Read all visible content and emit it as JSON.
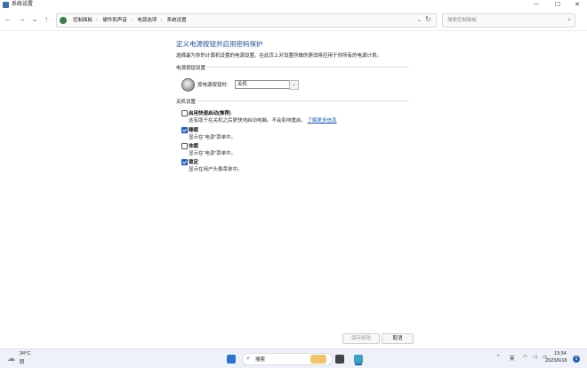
{
  "window": {
    "title": "系统设置",
    "min": "─",
    "max": "☐",
    "close": "✕"
  },
  "nav": {
    "back": "←",
    "forward": "→",
    "recent": "⌄",
    "up": "↑",
    "refresh": "↻",
    "addr_drop": "⌄"
  },
  "breadcrumbs": [
    "控制面板",
    "硬件和声音",
    "电源选项",
    "系统设置"
  ],
  "search": {
    "placeholder": "搜索控制面板"
  },
  "page": {
    "heading": "定义电源按钮并启用密码保护",
    "description": "选择最为你的计算机设置的电源设置。在此页上对设置所做的更改将应用于你所有的电源计划。"
  },
  "power_button_section": {
    "title": "电源按钮设置",
    "label": "按电源按钮时:",
    "value": "关机"
  },
  "shutdown_section": {
    "title": "关机设置",
    "options": [
      {
        "title": "启用快速启动(推荐)",
        "checked": false,
        "desc": "这有助于在关机之后更快地启动电脑。不会影响重启。",
        "link": "了解更多信息"
      },
      {
        "title": "睡眠",
        "checked": true,
        "desc": "显示在“电源”菜单中。"
      },
      {
        "title": "休眠",
        "checked": false,
        "desc": "显示在“电源”菜单中。"
      },
      {
        "title": "锁定",
        "checked": true,
        "desc": "显示在用户头像菜单中。"
      }
    ]
  },
  "buttons": {
    "save": "保存修改",
    "cancel": "取消"
  },
  "taskbar": {
    "weather_temp": "34°C",
    "weather_desc": "阴",
    "search_label": "搜索",
    "ime": "英",
    "time": "13:34",
    "date": "2023/6/18",
    "notifications": "1"
  },
  "colors": {
    "accent": "#1f5fbf",
    "heading": "#1d4f9a",
    "link": "#1d5bb8"
  }
}
